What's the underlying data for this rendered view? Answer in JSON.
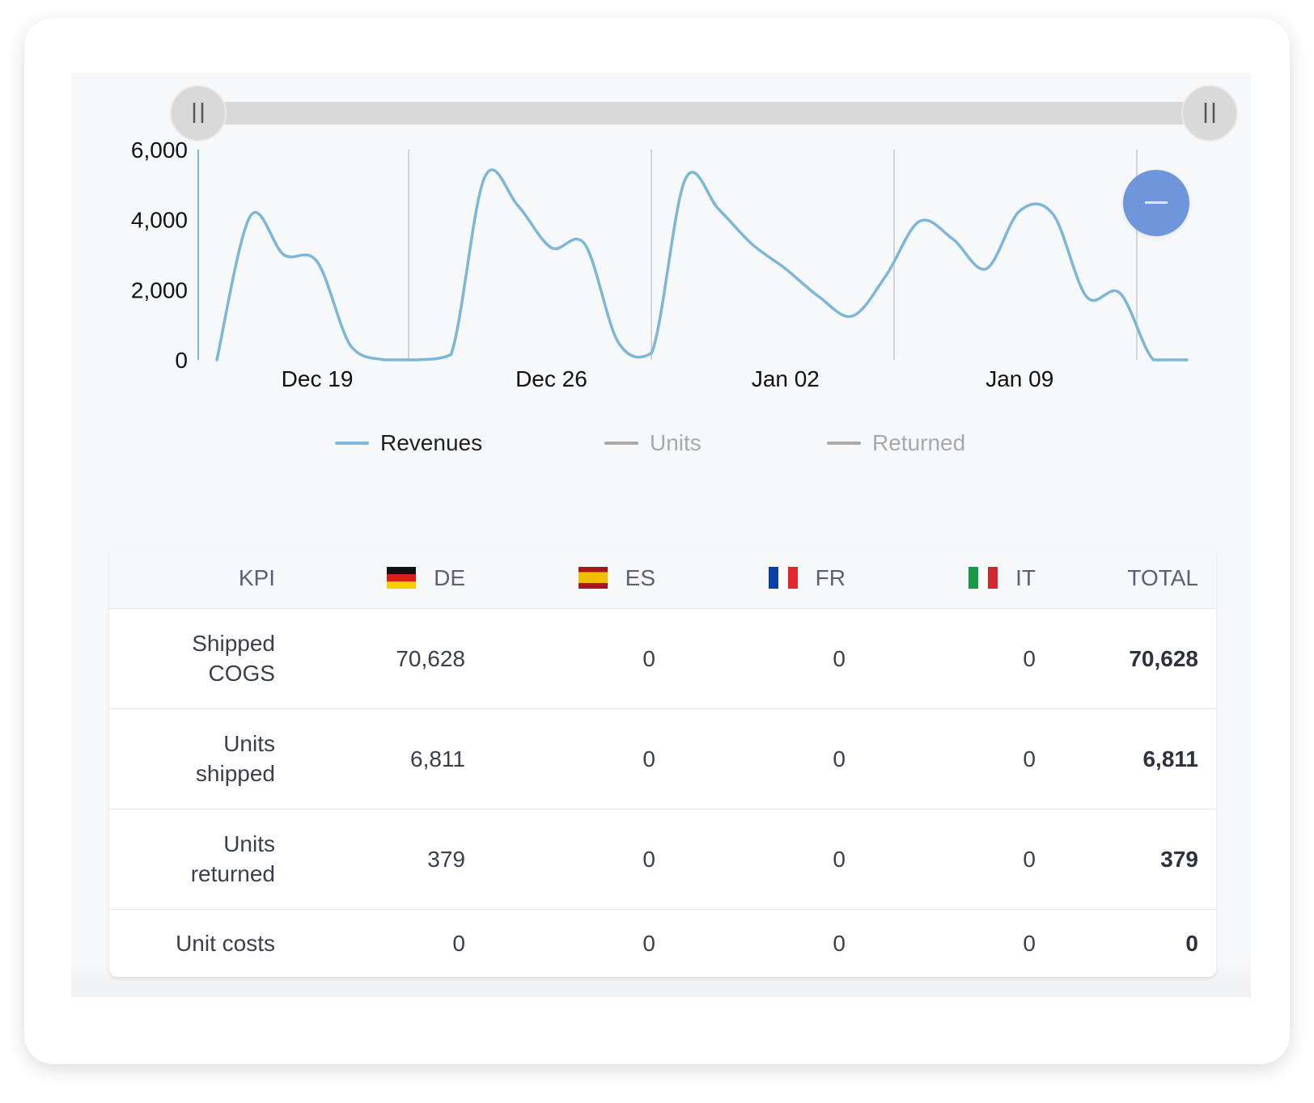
{
  "chart_data": {
    "type": "line",
    "ylim": [
      0,
      6000
    ],
    "yticks": [
      "6,000",
      "4,000",
      "2,000",
      "0"
    ],
    "ytick_values": [
      6000,
      4000,
      2000,
      0
    ],
    "xticks": [
      "Dec 19",
      "Dec 26",
      "Jan 02",
      "Jan 09"
    ],
    "x": [
      "Dec 16",
      "Dec 17",
      "Dec 18",
      "Dec 19",
      "Dec 20",
      "Dec 21",
      "Dec 22",
      "Dec 23",
      "Dec 24",
      "Dec 25",
      "Dec 26",
      "Dec 27",
      "Dec 28",
      "Dec 29",
      "Dec 30",
      "Dec 31",
      "Jan 01",
      "Jan 02",
      "Jan 03",
      "Jan 04",
      "Jan 05",
      "Jan 06",
      "Jan 07",
      "Jan 08",
      "Jan 09",
      "Jan 10",
      "Jan 11",
      "Jan 12",
      "Jan 13",
      "Jan 14"
    ],
    "series": [
      {
        "name": "Revenues",
        "color": "#7db7d8",
        "visible": true,
        "values": [
          0,
          4100,
          3000,
          2800,
          400,
          0,
          0,
          150,
          5200,
          4400,
          3200,
          3300,
          500,
          200,
          5150,
          4300,
          3300,
          2600,
          1800,
          1250,
          2400,
          3950,
          3450,
          2600,
          4250,
          4150,
          1800,
          1900,
          0,
          0
        ]
      },
      {
        "name": "Units",
        "color": "#a9a9a9",
        "visible": false
      },
      {
        "name": "Returned",
        "color": "#a9a9a9",
        "visible": false
      }
    ],
    "grid": true,
    "legend_placement": "bottom"
  },
  "zoom_control": {
    "minus_icon": "minus-icon",
    "handle_icon": "grip-icon"
  },
  "table": {
    "headers": {
      "kpi": "KPI",
      "de": "DE",
      "es": "ES",
      "fr": "FR",
      "it": "IT",
      "total": "TOTAL"
    },
    "rows": [
      {
        "kpi_line1": "Shipped",
        "kpi_line2": "COGS",
        "de": "70,628",
        "es": "0",
        "fr": "0",
        "it": "0",
        "total": "70,628"
      },
      {
        "kpi_line1": "Units",
        "kpi_line2": "shipped",
        "de": "6,811",
        "es": "0",
        "fr": "0",
        "it": "0",
        "total": "6,811"
      },
      {
        "kpi_line1": "Units",
        "kpi_line2": "returned",
        "de": "379",
        "es": "0",
        "fr": "0",
        "it": "0",
        "total": "379"
      },
      {
        "kpi_line1": "Unit costs",
        "kpi_line2": "",
        "de": "0",
        "es": "0",
        "fr": "0",
        "it": "0",
        "total": "0"
      }
    ]
  }
}
